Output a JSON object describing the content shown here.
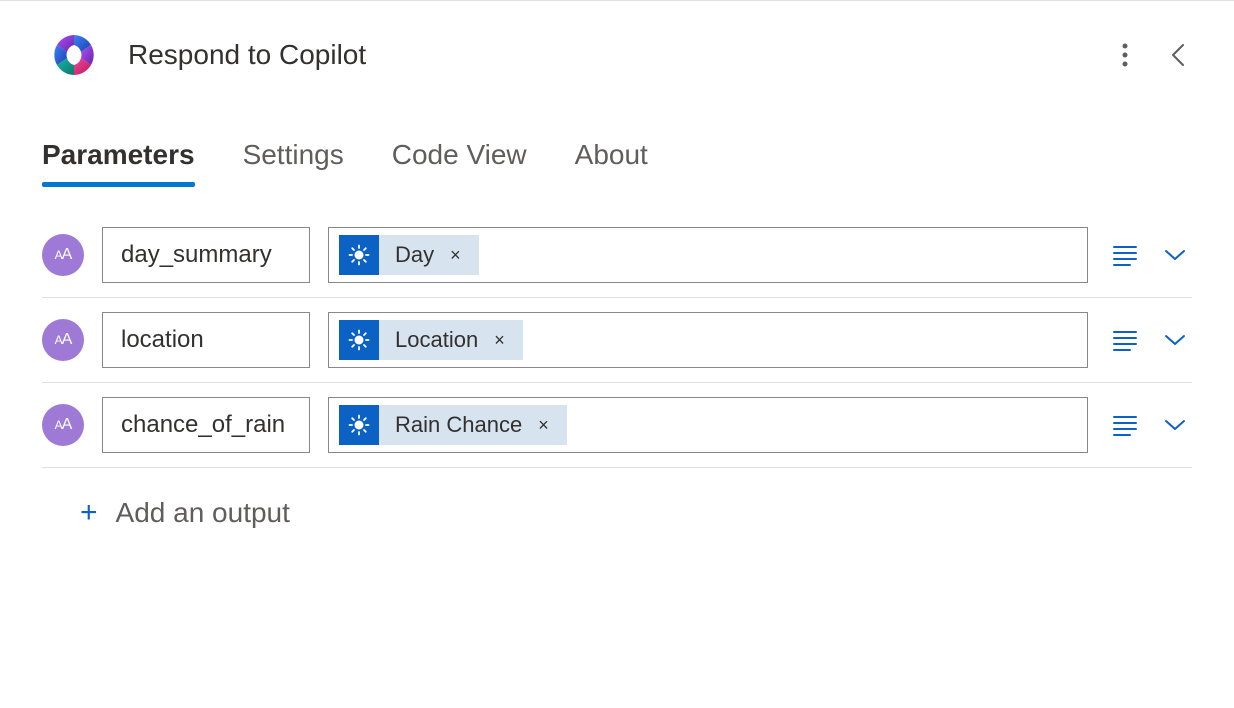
{
  "header": {
    "title": "Respond to Copilot"
  },
  "tabs": [
    {
      "label": "Parameters",
      "active": true
    },
    {
      "label": "Settings",
      "active": false
    },
    {
      "label": "Code View",
      "active": false
    },
    {
      "label": "About",
      "active": false
    }
  ],
  "parameters": [
    {
      "name": "day_summary",
      "token_label": "Day"
    },
    {
      "name": "location",
      "token_label": "Location"
    },
    {
      "name": "chance_of_rain",
      "token_label": "Rain Chance"
    }
  ],
  "add_output_label": "Add an output"
}
